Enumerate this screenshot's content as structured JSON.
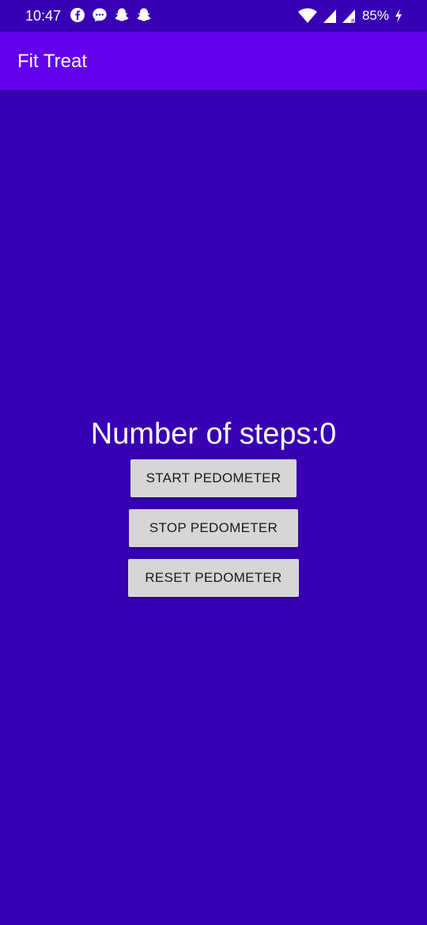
{
  "status_bar": {
    "time": "10:47",
    "notification_icons": [
      "facebook-icon",
      "messenger-icon",
      "snapchat-icon",
      "snapchat-icon"
    ],
    "battery": "85%"
  },
  "app_bar": {
    "title": "Fit Treat"
  },
  "main": {
    "steps_text": "Number of steps:0",
    "start_button": "START PEDOMETER",
    "stop_button": "STOP PEDOMETER",
    "reset_button": "RESET PEDOMETER"
  },
  "colors": {
    "background": "#3700B3",
    "app_bar": "#6200EE",
    "button": "#D6D6D6"
  }
}
